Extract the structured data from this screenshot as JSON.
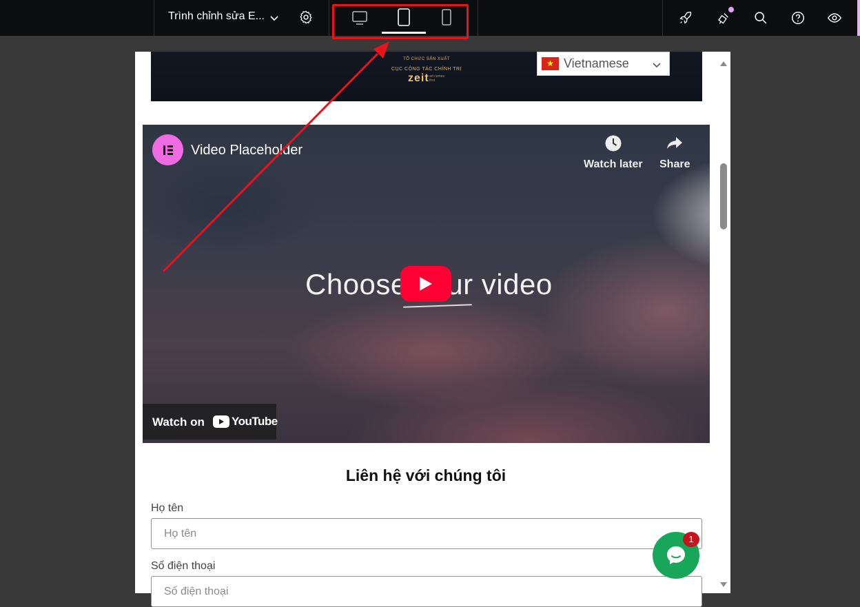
{
  "toolbar": {
    "document_title": "Trình chỉnh sửa E...",
    "devices": [
      "desktop-view",
      "tablet-view",
      "mobile-view"
    ],
    "active_device": "tablet-view",
    "right_icons": [
      "rocket-icon",
      "announcements-icon",
      "search-icon",
      "help-icon",
      "preview-eye-icon"
    ]
  },
  "banner": {
    "line1": "TỔ CHỨC SẢN XUẤT",
    "line2": "CỤC CÔNG TÁC CHÍNH TRỊ",
    "logo": "zeit",
    "logo_tagline": "art comes first"
  },
  "language_switcher": {
    "selected": "Vietnamese",
    "flag": "vietnam-flag-icon"
  },
  "video": {
    "channel_title": "Video Placeholder",
    "watch_later": "Watch later",
    "share": "Share",
    "overlay_text": "Choose your video",
    "watch_on": "Watch on",
    "youtube": "YouTube"
  },
  "contact": {
    "title": "Liên hệ với chúng tôi",
    "name_label": "Họ tên",
    "name_placeholder": "Họ tên",
    "phone_label": "Số điện thoại",
    "phone_placeholder": "Số điện thoại"
  },
  "chat": {
    "badge_count": "1",
    "accent": "#17a65a"
  },
  "colors": {
    "annotation": "#e8131b",
    "youtube_red": "#ff0033",
    "elementor_pink": "#f06be1"
  }
}
